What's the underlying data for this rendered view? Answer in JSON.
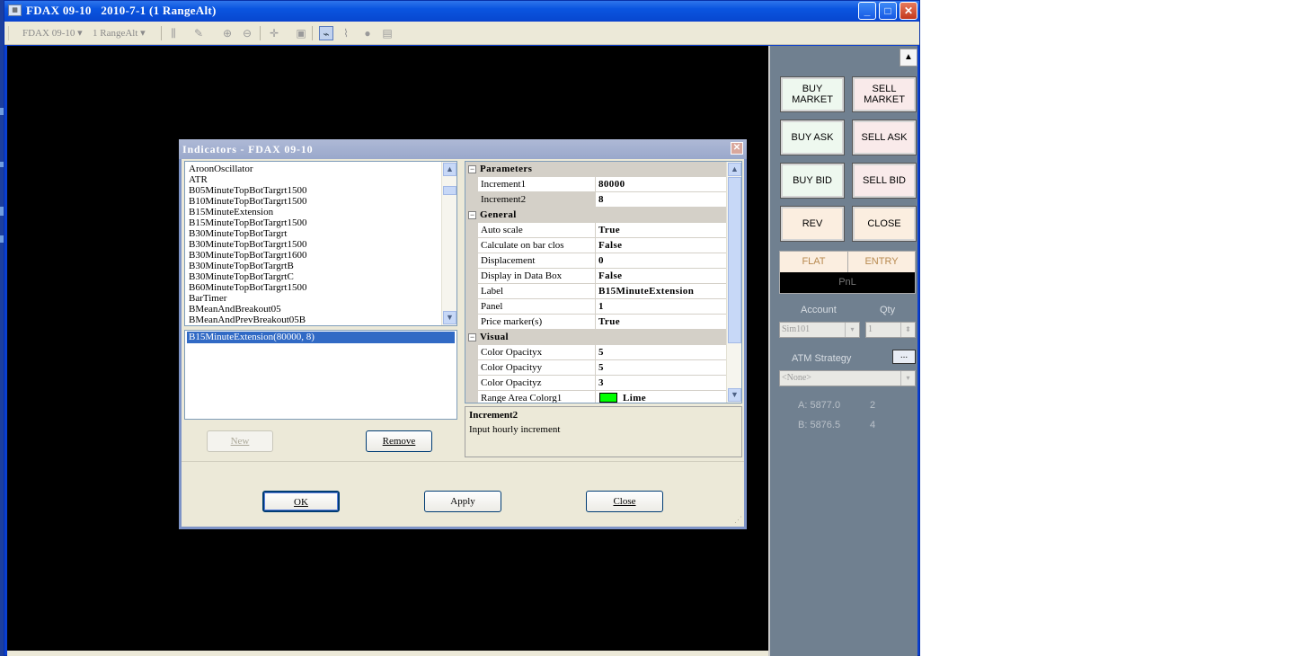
{
  "window": {
    "title": "FDAX 09-10   2010-7-1 (1 RangeAlt)",
    "app_icon": "chart-icon",
    "minimize": "_",
    "maximize": "□",
    "close": "✕"
  },
  "toolbar": {
    "instrument": "FDAX 09-10 ▾",
    "period": "1 RangeAlt ▾",
    "icons": [
      "bar-style-icon",
      "draw-pencil-icon",
      "zoom-in-icon",
      "zoom-out-icon",
      "crosshair-icon",
      "properties-icon",
      "indicators-icon",
      "strategies-icon",
      "chart-trader-icon",
      "data-box-icon"
    ]
  },
  "dialog": {
    "title": "Indicators - FDAX 09-10",
    "indicators": [
      "AroonOscillator",
      "ATR",
      "B05MinuteTopBotTargrt1500",
      "B10MinuteTopBotTargrt1500",
      "B15MinuteExtension",
      "B15MinuteTopBotTargrt1500",
      "B30MinuteTopBotTargrt",
      "B30MinuteTopBotTargrt1500",
      "B30MinuteTopBotTargrt1600",
      "B30MinuteTopBotTargrtB",
      "B30MinuteTopBotTargrtC",
      "B60MinuteTopBotTargrt1500",
      "BarTimer",
      "BMeanAndBreakout05",
      "BMeanAndPrevBreakout05B"
    ],
    "applied": [
      "B15MinuteExtension(80000, 8)"
    ],
    "new_label": "New",
    "remove_label": "Remove",
    "properties": {
      "parameters_label": "Parameters",
      "increment1_name": "Increment1",
      "increment1_value": "80000",
      "increment2_name": "Increment2",
      "increment2_value": "8",
      "general_label": "General",
      "autoscale_name": "Auto scale",
      "autoscale_value": "True",
      "calc_name": "Calculate on bar clos",
      "calc_value": "False",
      "displacement_name": "Displacement",
      "displacement_value": "0",
      "databox_name": "Display in Data Box",
      "databox_value": "False",
      "label_name": "Label",
      "label_value": "B15MinuteExtension",
      "panel_name": "Panel",
      "panel_value": "1",
      "pricemarker_name": "Price marker(s)",
      "pricemarker_value": "True",
      "visual_label": "Visual",
      "opx_name": "Color Opacityx",
      "opx_value": "5",
      "opy_name": "Color Opacityy",
      "opy_value": "5",
      "opz_name": "Color Opacityz",
      "opz_value": "3",
      "rac_name": "Range Area Colorg1",
      "rac_value": "Lime",
      "rac_color": "#00ff00"
    },
    "description_title": "Increment2",
    "description_text": "Input hourly increment",
    "ok_label": "OK",
    "apply_label": "Apply",
    "close_label": "Close"
  },
  "order_panel": {
    "buy_market": "BUY\nMARKET",
    "sell_market": "SELL\nMARKET",
    "buy_ask": "BUY ASK",
    "sell_ask": "SELL ASK",
    "buy_bid": "BUY BID",
    "sell_bid": "SELL BID",
    "rev": "REV",
    "close": "CLOSE",
    "position": "FLAT",
    "entry": "ENTRY",
    "pnl": "PnL",
    "account_label": "Account",
    "qty_label": "Qty",
    "account_value": "Sim101",
    "qty_value": "1",
    "atm_label": "ATM Strategy",
    "atm_dots": "...",
    "atm_value": "<None>",
    "ask": "A: 5877.0",
    "ask_size": "2",
    "bid": "B: 5876.5",
    "bid_size": "4"
  },
  "colors": {
    "title_blue": "#0a55e0",
    "chart_bg": "#000000",
    "panel_bg": "#708090",
    "selection": "#316ac5"
  }
}
